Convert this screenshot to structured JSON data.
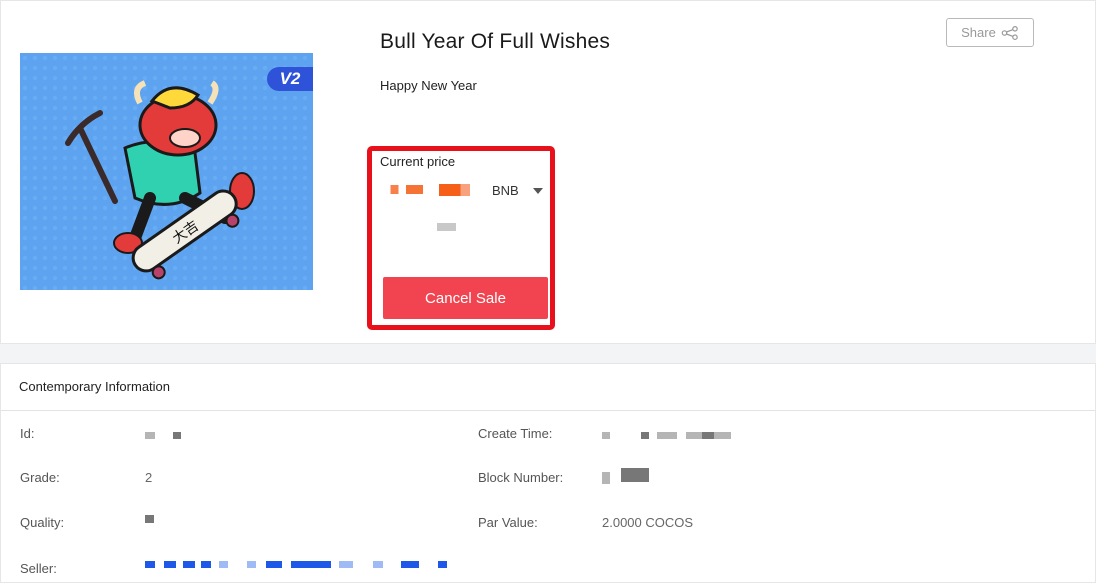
{
  "item": {
    "title": "Bull Year Of Full Wishes",
    "description": "Happy New Year",
    "badge": "V2",
    "image_icon": "bull-mascot-skateboard"
  },
  "share": {
    "label": "Share",
    "icon": "share-icon"
  },
  "price": {
    "label": "Current price",
    "currency": "BNB",
    "highlight_color": "#e8101a"
  },
  "actions": {
    "cancel_label": "Cancel Sale",
    "cancel_color": "#f24450"
  },
  "info": {
    "header": "Contemporary Information",
    "id_label": "Id:",
    "grade_label": "Grade:",
    "grade_value": "2",
    "quality_label": "Quality:",
    "seller_label": "Seller:",
    "create_time_label": "Create Time:",
    "block_number_label": "Block Number:",
    "par_value_label": "Par Value:",
    "par_value": "2.0000 COCOS"
  }
}
